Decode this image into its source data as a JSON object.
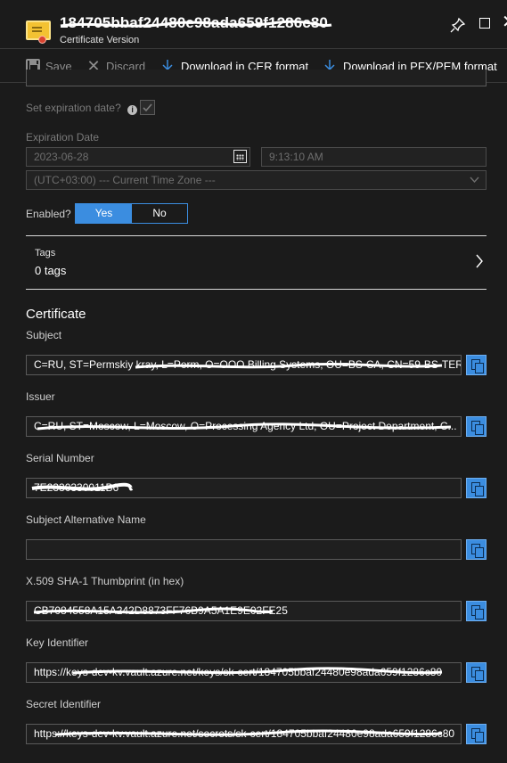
{
  "header": {
    "title": "184705bbaf24480e98ada659f1286c80",
    "subtitle": "Certificate Version",
    "icon": "certificate-icon"
  },
  "toolbar": {
    "save_label": "Save",
    "discard_label": "Discard",
    "download_cer_label": "Download in CER format",
    "download_pfx_label": "Download in PFX/PEM format"
  },
  "expiration": {
    "set_label": "Set expiration date?",
    "checked": true,
    "date_label": "Expiration Date",
    "date_value": "2023-06-28",
    "time_value": "9:13:10 AM",
    "timezone_value": "(UTC+03:00) --- Current Time Zone ---"
  },
  "enabled": {
    "label": "Enabled?",
    "yes_label": "Yes",
    "no_label": "No",
    "selected": "Yes"
  },
  "tags": {
    "label": "Tags",
    "value": "0 tags"
  },
  "certificate": {
    "section_title": "Certificate",
    "subject_label": "Subject",
    "subject_value": "C=RU, ST=Permskiy kray, L=Perm, O=OOO Billing Systems, OU=BS-CA, CN=59-BS-TER...",
    "issuer_label": "Issuer",
    "issuer_value": "C=RU, ST=Moscow, L=Moscow, O=Processing Agency Ltd, OU=Project Department, C...",
    "serial_label": "Serial Number",
    "serial_value": "7E2330330011B6",
    "san_label": "Subject Alternative Name",
    "san_value": "",
    "thumb_label": "X.509 SHA-1 Thumbprint (in hex)",
    "thumb_value": "CB7084558A15A242D8873FF76B9A5A1E9E02FE25",
    "keyid_label": "Key Identifier",
    "keyid_value": "https://keys-dev-kv.vault.azure.net/keys/sk-cert/184705bbaf24480e98ada659f1286c80",
    "secretid_label": "Secret Identifier",
    "secretid_value": "https://keys-dev-kv.vault.azure.net/secrets/sk-cert/184705bbaf24480e98ada659f1286c80"
  },
  "colors": {
    "background": "#1b1b1b",
    "accent": "#3b8de0",
    "toggle_selected": "#3b8de0"
  }
}
